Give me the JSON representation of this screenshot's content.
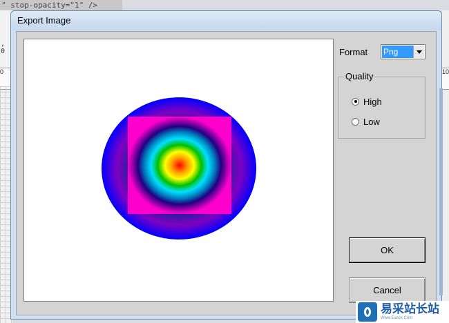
{
  "background": {
    "code_snippet": "\" stop-opacity=\"1\" />",
    "left_code_fragment": ", 0",
    "ruler_left": "0",
    "ruler_right": "10"
  },
  "dialog": {
    "title": "Export Image",
    "format": {
      "label": "Format",
      "selected": "Png"
    },
    "quality": {
      "legend": "Quality",
      "options": [
        {
          "label": "High",
          "checked": true
        },
        {
          "label": "Low",
          "checked": false
        }
      ]
    },
    "buttons": {
      "ok": "OK",
      "cancel": "Cancel"
    },
    "preview": {
      "description_colors": {
        "ellipse_center": "#ff0000",
        "ellipse_edge": "#0000ff",
        "square_fill": "#ff00cc"
      }
    }
  },
  "watermark": {
    "main": "易采站长站",
    "sub": "Www.Easck.Com"
  }
}
